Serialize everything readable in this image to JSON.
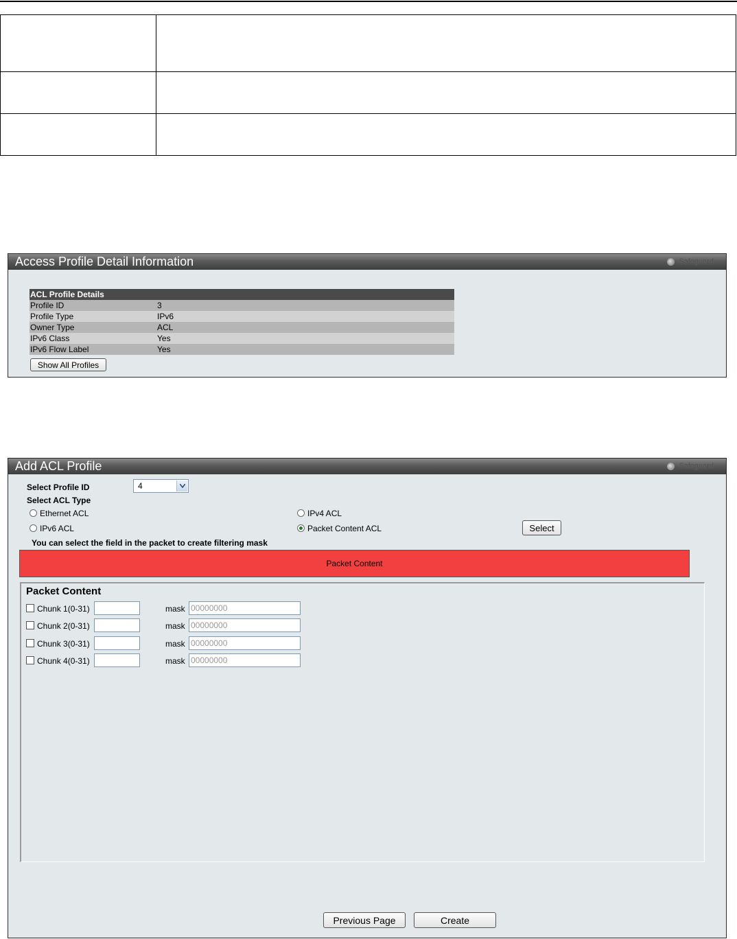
{
  "access_profile_detail": {
    "title": "Access Profile Detail Information",
    "safeguard": "Safeguard",
    "table_header": "ACL Profile Details",
    "rows": [
      {
        "key": "Profile ID",
        "value": "3"
      },
      {
        "key": "Profile Type",
        "value": "IPv6"
      },
      {
        "key": "Owner Type",
        "value": "ACL"
      },
      {
        "key": "IPv6 Class",
        "value": "Yes"
      },
      {
        "key": "IPv6 Flow Label",
        "value": "Yes"
      }
    ],
    "show_all_button": "Show All Profiles"
  },
  "add_acl_profile": {
    "title": "Add ACL Profile",
    "safeguard": "Safeguard",
    "select_profile_label": "Select Profile ID",
    "profile_id_value": "4",
    "select_acl_type_label": "Select ACL Type",
    "acl_types": [
      {
        "label": "Ethernet ACL",
        "selected": false
      },
      {
        "label": "IPv4 ACL",
        "selected": false
      },
      {
        "label": "IPv6 ACL",
        "selected": false
      },
      {
        "label": "Packet Content ACL",
        "selected": true
      }
    ],
    "select_button": "Select",
    "hint": "You can select the field in the packet to create filtering mask",
    "packet_content_bar": "Packet Content",
    "packet_content_title": "Packet Content",
    "chunks": [
      {
        "label": "Chunk 1(0-31)",
        "value": "",
        "mask_label": "mask",
        "mask_placeholder": "00000000"
      },
      {
        "label": "Chunk 2(0-31)",
        "value": "",
        "mask_label": "mask",
        "mask_placeholder": "00000000"
      },
      {
        "label": "Chunk 3(0-31)",
        "value": "",
        "mask_label": "mask",
        "mask_placeholder": "00000000"
      },
      {
        "label": "Chunk 4(0-31)",
        "value": "",
        "mask_label": "mask",
        "mask_placeholder": "00000000"
      }
    ],
    "previous_button": "Previous Page",
    "create_button": "Create"
  },
  "colors": {
    "panel_bg": "#e3e8ea",
    "title_bar": "#4a4a4a",
    "packet_content_bar": "#f24040"
  }
}
